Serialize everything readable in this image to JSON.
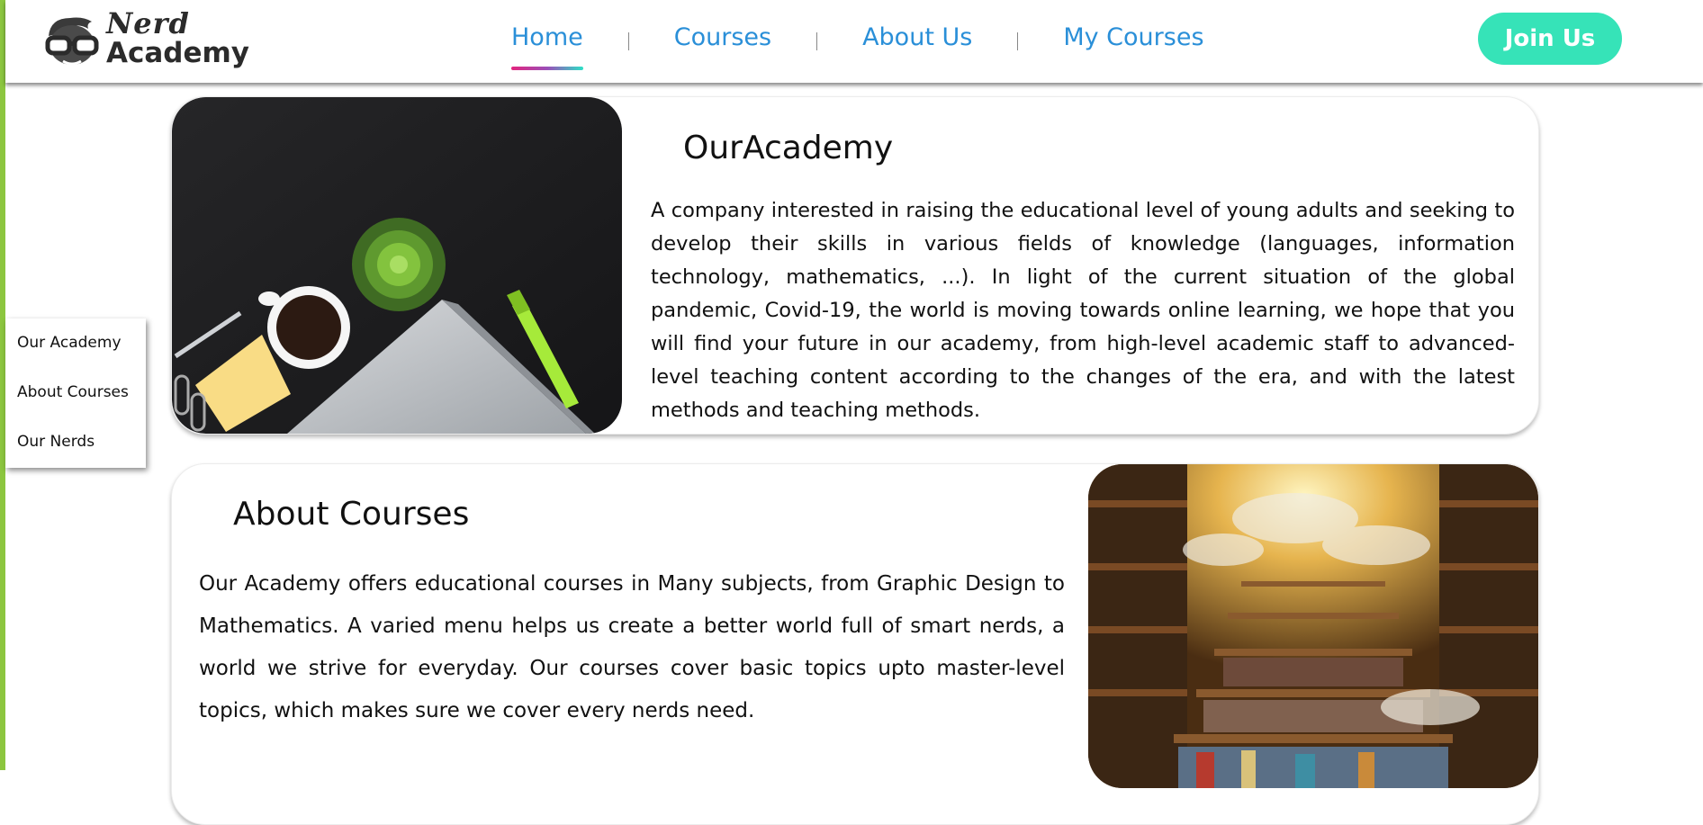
{
  "logo": {
    "line1": "Nerd",
    "line2": "Academy"
  },
  "nav": {
    "items": [
      {
        "label": "Home",
        "active": true
      },
      {
        "label": "Courses",
        "active": false
      },
      {
        "label": "About Us",
        "active": false
      },
      {
        "label": "My Courses",
        "active": false
      }
    ],
    "join_label": "Join Us"
  },
  "side_menu": {
    "items": [
      "Our Academy",
      "About Courses",
      "Our Nerds"
    ]
  },
  "sections": {
    "academy": {
      "title": "OurAcademy",
      "text": "A company interested in raising the educational level of young adults and seeking to develop their skills in various fields of knowledge (languages, information technology, mathematics, ...). In light of the current situation of the global pandemic, Covid-19, the world is moving towards online learning, we hope that you will find your future in our academy, from high-level academic staff to advanced-level teaching content according to the changes of the era, and with the latest methods and teaching methods."
    },
    "courses": {
      "title": "About Courses",
      "text": "Our Academy offers educational courses in Many subjects, from Graphic Design to Mathematics. A varied menu helps us create a better world full of smart nerds, a world we strive for everyday. Our courses cover basic topics upto master-level topics, which makes sure we cover every nerds need."
    }
  },
  "colors": {
    "accent_green": "#8cc63f",
    "nav_blue": "#2a8fd8",
    "join_button": "#36e3b8"
  },
  "icons": [
    "nerd-logo-icon"
  ]
}
